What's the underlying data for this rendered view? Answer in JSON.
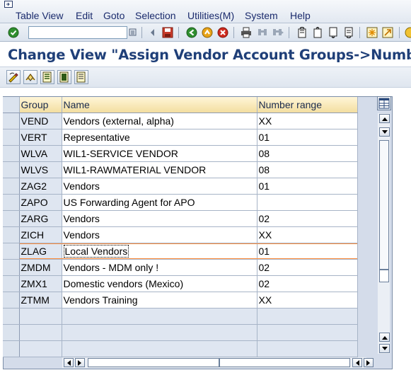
{
  "menu": {
    "items": [
      "Table View",
      "Edit",
      "Goto",
      "Selection",
      "Utilities(M)",
      "System",
      "Help"
    ]
  },
  "toolbar": {
    "command_value": "",
    "icons": [
      "enter-icon",
      "save-icon",
      "back-icon",
      "exit-icon",
      "cancel-icon",
      "print-icon",
      "find-icon",
      "find-next-icon",
      "first-page-icon",
      "previous-page-icon",
      "next-page-icon",
      "last-page-icon",
      "create-session-icon",
      "shortcut-icon"
    ]
  },
  "title": "Change View \"Assign Vendor Account Groups->Number",
  "app_toolbar": {
    "icons": [
      "display-change-icon",
      "other-entry-icon",
      "details-icon",
      "select-all-icon",
      "deselect-all-icon"
    ]
  },
  "table": {
    "columns": [
      "Group",
      "Name",
      "Number range"
    ],
    "rows": [
      {
        "group": "VEND",
        "name": "Vendors (external, alpha)",
        "number_range": "XX"
      },
      {
        "group": "VERT",
        "name": "Representative",
        "number_range": "01"
      },
      {
        "group": "WLVA",
        "name": "WIL1-SERVICE VENDOR",
        "number_range": "08"
      },
      {
        "group": "WLVS",
        "name": "WIL1-RAWMATERIAL VENDOR",
        "number_range": "08"
      },
      {
        "group": "ZAG2",
        "name": "Vendors",
        "number_range": "01"
      },
      {
        "group": "ZAPO",
        "name": "US Forwarding Agent for APO",
        "number_range": ""
      },
      {
        "group": "ZARG",
        "name": "Vendors",
        "number_range": "02"
      },
      {
        "group": "ZICH",
        "name": "Vendors",
        "number_range": "XX"
      },
      {
        "group": "ZLAG",
        "name": "Local Vendors",
        "number_range": "01"
      },
      {
        "group": "ZMDM",
        "name": "Vendors - MDM only !",
        "number_range": "02"
      },
      {
        "group": "ZMX1",
        "name": "Domestic vendors (Mexico)",
        "number_range": "02"
      },
      {
        "group": "ZTMM",
        "name": "Vendors Training",
        "number_range": "XX"
      }
    ],
    "empty_rows": 3,
    "focused_row_group": "ZLAG",
    "scroll_position_fraction": 0.88
  },
  "colors": {
    "title": "#1f3f78",
    "header_bg": "#f3dea0",
    "focus_line": "#ff8c3a"
  }
}
